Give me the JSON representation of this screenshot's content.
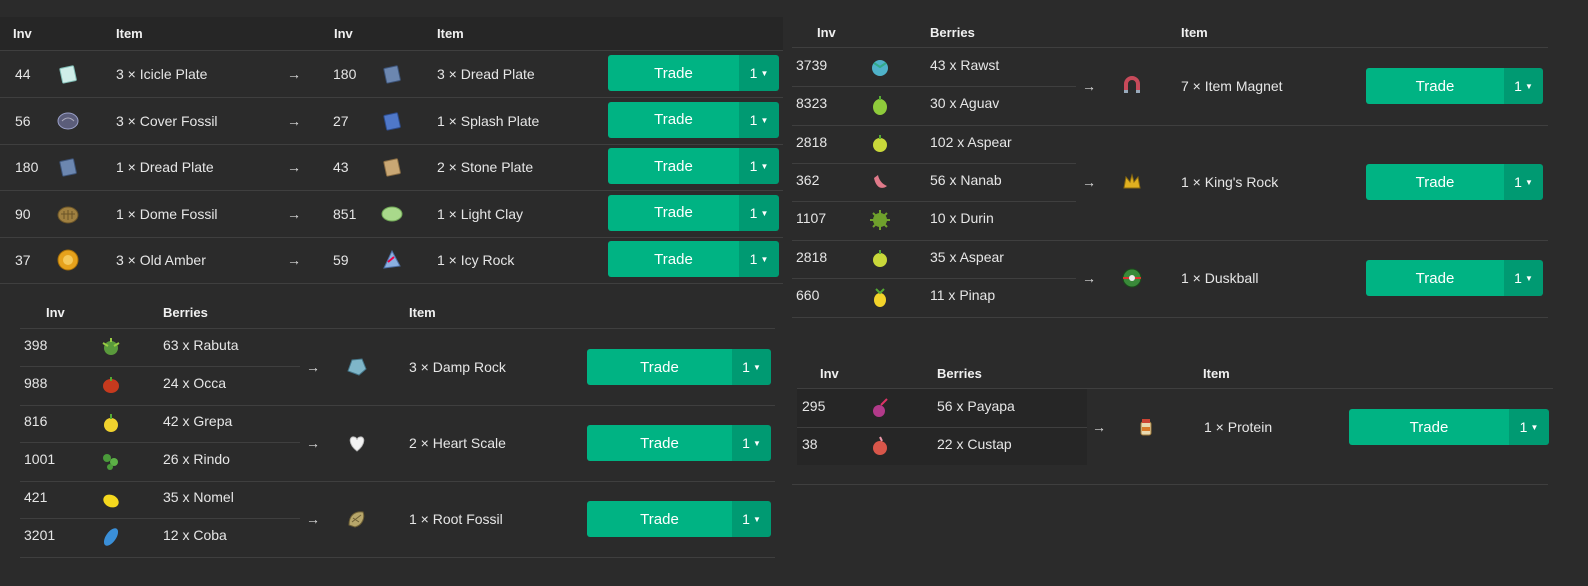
{
  "headers": {
    "inv": "Inv",
    "item": "Item",
    "berries": "Berries"
  },
  "arrow": "→",
  "trade_label": "Trade",
  "qty_value": "1",
  "top_left": [
    {
      "inv": "44",
      "item": "3 × Icicle Plate",
      "icon": "icicle-plate-icon",
      "out_inv": "180",
      "out_item": "3 × Dread Plate",
      "out_icon": "dread-plate-icon"
    },
    {
      "inv": "56",
      "item": "3 × Cover Fossil",
      "icon": "cover-fossil-icon",
      "out_inv": "27",
      "out_item": "1 × Splash Plate",
      "out_icon": "splash-plate-icon"
    },
    {
      "inv": "180",
      "item": "1 × Dread Plate",
      "icon": "dread-plate-icon",
      "out_inv": "43",
      "out_item": "2 × Stone Plate",
      "out_icon": "stone-plate-icon"
    },
    {
      "inv": "90",
      "item": "1 × Dome Fossil",
      "icon": "dome-fossil-icon",
      "out_inv": "851",
      "out_item": "1 × Light Clay",
      "out_icon": "light-clay-icon"
    },
    {
      "inv": "37",
      "item": "3 × Old Amber",
      "icon": "old-amber-icon",
      "out_inv": "59",
      "out_item": "1 × Icy Rock",
      "out_icon": "icy-rock-icon"
    }
  ],
  "bottom_left": [
    {
      "inputs": [
        {
          "inv": "398",
          "item": "63 x Rabuta",
          "icon": "rabuta-berry-icon"
        },
        {
          "inv": "988",
          "item": "24 x Occa",
          "icon": "occa-berry-icon"
        }
      ],
      "out_item": "3 × Damp Rock",
      "out_icon": "damp-rock-icon"
    },
    {
      "inputs": [
        {
          "inv": "816",
          "item": "42 x Grepa",
          "icon": "grepa-berry-icon"
        },
        {
          "inv": "1001",
          "item": "26 x Rindo",
          "icon": "rindo-berry-icon"
        }
      ],
      "out_item": "2 × Heart Scale",
      "out_icon": "heart-scale-icon"
    },
    {
      "inputs": [
        {
          "inv": "421",
          "item": "35 x Nomel",
          "icon": "nomel-berry-icon"
        },
        {
          "inv": "3201",
          "item": "12 x Coba",
          "icon": "coba-berry-icon"
        }
      ],
      "out_item": "1 × Root Fossil",
      "out_icon": "root-fossil-icon"
    }
  ],
  "right_top": [
    {
      "inputs": [
        {
          "inv": "3739",
          "item": "43 x Rawst",
          "icon": "rawst-berry-icon"
        },
        {
          "inv": "8323",
          "item": "30 x Aguav",
          "icon": "aguav-berry-icon"
        }
      ],
      "out_item": "7 × Item Magnet",
      "out_icon": "magnet-icon"
    },
    {
      "inputs": [
        {
          "inv": "2818",
          "item": "102 x Aspear",
          "icon": "aspear-berry-icon"
        },
        {
          "inv": "362",
          "item": "56 x Nanab",
          "icon": "nanab-berry-icon"
        },
        {
          "inv": "1107",
          "item": "10 x Durin",
          "icon": "durin-berry-icon"
        }
      ],
      "out_item": "1 × King's Rock",
      "out_icon": "kings-rock-icon"
    },
    {
      "inputs": [
        {
          "inv": "2818",
          "item": "35 x Aspear",
          "icon": "aspear-berry-icon"
        },
        {
          "inv": "660",
          "item": "11 x Pinap",
          "icon": "pinap-berry-icon"
        }
      ],
      "out_item": "1 × Duskball",
      "out_icon": "duskball-icon"
    }
  ],
  "right_bottom": [
    {
      "inputs": [
        {
          "inv": "295",
          "item": "56 x Payapa",
          "icon": "payapa-berry-icon"
        },
        {
          "inv": "38",
          "item": "22 x Custap",
          "icon": "custap-berry-icon"
        }
      ],
      "out_item": "1 × Protein",
      "out_icon": "protein-icon"
    }
  ]
}
